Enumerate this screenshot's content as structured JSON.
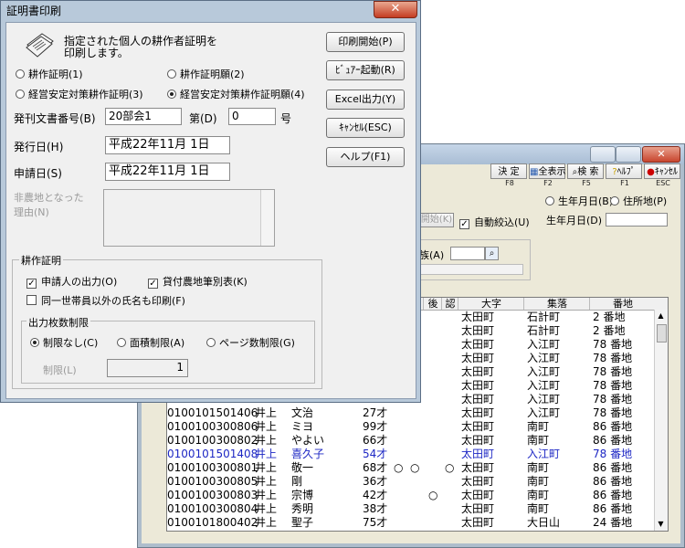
{
  "dialog": {
    "title": "証明書印刷",
    "close_glyph": "✕",
    "description_line1": "指定された個人の耕作者証明を",
    "description_line2": "印刷します。",
    "icon": "document-stack-icon",
    "radios": [
      {
        "label": "耕作証明(1)",
        "selected": false
      },
      {
        "label": "耕作証明願(2)",
        "selected": false
      },
      {
        "label": "経営安定対策耕作証明(3)",
        "selected": false
      },
      {
        "label": "経営安定対策耕作証明願(4)",
        "selected": true
      }
    ],
    "doc_no_label": "発刊文書番号(B)",
    "doc_no_value": "20部会1",
    "dai_label": "第(D)",
    "dai_value": "0",
    "go_label": "号",
    "issue_date_label": "発行日(H)",
    "issue_date_value": "平成22年11月 1日",
    "apply_date_label": "申請日(S)",
    "apply_date_value": "平成22年11月 1日",
    "nonfarm_label_1": "非農地となった",
    "nonfarm_label_2": "理由(N)",
    "group_title": "耕作証明",
    "checks": [
      {
        "label": "申請人の出力(O)",
        "checked": true
      },
      {
        "label": "貸付農地筆別表(K)",
        "checked": true
      },
      {
        "label": "同一世帯員以外の氏名も印刷(F)",
        "checked": false
      }
    ],
    "limit_group_title": "出力枚数制限",
    "limit_radios": [
      {
        "label": "制限なし(C)",
        "selected": true
      },
      {
        "label": "面積制限(A)",
        "selected": false
      },
      {
        "label": "ページ数制限(G)",
        "selected": false
      }
    ],
    "limit_label": "制限(L)",
    "limit_value": "1",
    "buttons": {
      "print": "印刷開始(P)",
      "viewer": "ﾋﾞｭｱｰ起動(R)",
      "excel": "Excel出力(Y)",
      "cancel": "ｷｬﾝｾﾙ(ESC)",
      "help": "ヘルプ(F1)"
    }
  },
  "bg_window": {
    "toolbar": [
      {
        "label": "決 定",
        "key": "F8"
      },
      {
        "label": "全表示",
        "key": "F2"
      },
      {
        "label": "検 索",
        "key": "F5"
      },
      {
        "label": "ﾍﾙﾌﾟ",
        "key": "F1"
      },
      {
        "label": "ｷｬﾝｾﾙ",
        "key": "ESC"
      }
    ],
    "radio_birth": "生年月日(B)",
    "radio_address": "住所地(P)",
    "birth_label": "生年月日(D)",
    "partial_button": "開始(K)",
    "auto_filter": "自動絞込(U)",
    "partial_label": "族(A)",
    "headers": [
      "後",
      "認",
      "大字",
      "集落",
      "番地"
    ],
    "rows": [
      {
        "id": "",
        "sei": "",
        "mei": "",
        "age": "",
        "m1": "",
        "m2": "",
        "m3": "",
        "m4": "",
        "oaza": "太田町",
        "shuraku": "石計町",
        "banchi": "2 番地",
        "hl": false
      },
      {
        "id": "",
        "sei": "",
        "mei": "",
        "age": "",
        "m1": "",
        "m2": "",
        "m3": "",
        "m4": "",
        "oaza": "太田町",
        "shuraku": "石計町",
        "banchi": "2 番地",
        "hl": false
      },
      {
        "id": "",
        "sei": "",
        "mei": "",
        "age": "",
        "m1": "",
        "m2": "",
        "m3": "",
        "m4": "",
        "oaza": "太田町",
        "shuraku": "入江町",
        "banchi": "78 番地",
        "hl": false
      },
      {
        "id": "",
        "sei": "",
        "mei": "",
        "age": "",
        "m1": "",
        "m2": "",
        "m3": "",
        "m4": "",
        "oaza": "太田町",
        "shuraku": "入江町",
        "banchi": "78 番地",
        "hl": false
      },
      {
        "id": "",
        "sei": "",
        "mei": "",
        "age": "",
        "m1": "",
        "m2": "",
        "m3": "",
        "m4": "",
        "oaza": "太田町",
        "shuraku": "入江町",
        "banchi": "78 番地",
        "hl": false
      },
      {
        "id": "",
        "sei": "",
        "mei": "",
        "age": "",
        "m1": "",
        "m2": "",
        "m3": "",
        "m4": "",
        "oaza": "太田町",
        "shuraku": "入江町",
        "banchi": "78 番地",
        "hl": false
      },
      {
        "id": "",
        "sei": "",
        "mei": "",
        "age": "",
        "m1": "",
        "m2": "",
        "m3": "",
        "m4": "",
        "oaza": "太田町",
        "shuraku": "入江町",
        "banchi": "78 番地",
        "hl": false
      },
      {
        "id": "0100101501406",
        "sei": "井上",
        "mei": "文治",
        "age": "27才",
        "m1": "",
        "m2": "",
        "m3": "",
        "m4": "",
        "oaza": "太田町",
        "shuraku": "入江町",
        "banchi": "78 番地",
        "hl": false
      },
      {
        "id": "0100100300806",
        "sei": "井上",
        "mei": "ミヨ",
        "age": "99才",
        "m1": "",
        "m2": "",
        "m3": "",
        "m4": "",
        "oaza": "太田町",
        "shuraku": "南町",
        "banchi": "86 番地",
        "hl": false
      },
      {
        "id": "0100100300802",
        "sei": "井上",
        "mei": "やよい",
        "age": "66才",
        "m1": "",
        "m2": "",
        "m3": "",
        "m4": "",
        "oaza": "太田町",
        "shuraku": "南町",
        "banchi": "86 番地",
        "hl": false
      },
      {
        "id": "0100101501408",
        "sei": "井上",
        "mei": "喜久子",
        "age": "54才",
        "m1": "",
        "m2": "",
        "m3": "",
        "m4": "",
        "oaza": "太田町",
        "shuraku": "入江町",
        "banchi": "78 番地",
        "hl": true
      },
      {
        "id": "0100100300801",
        "sei": "井上",
        "mei": "敬一",
        "age": "68才",
        "m1": "○",
        "m2": "○",
        "m3": "",
        "m4": "○",
        "oaza": "太田町",
        "shuraku": "南町",
        "banchi": "86 番地",
        "hl": false
      },
      {
        "id": "0100100300805",
        "sei": "井上",
        "mei": "剛",
        "age": "36才",
        "m1": "",
        "m2": "",
        "m3": "",
        "m4": "",
        "oaza": "太田町",
        "shuraku": "南町",
        "banchi": "86 番地",
        "hl": false
      },
      {
        "id": "0100100300803",
        "sei": "井上",
        "mei": "宗博",
        "age": "42才",
        "m1": "",
        "m2": "",
        "m3": "○",
        "m4": "",
        "oaza": "太田町",
        "shuraku": "南町",
        "banchi": "86 番地",
        "hl": false
      },
      {
        "id": "0100100300804",
        "sei": "井上",
        "mei": "秀明",
        "age": "38才",
        "m1": "",
        "m2": "",
        "m3": "",
        "m4": "",
        "oaza": "太田町",
        "shuraku": "南町",
        "banchi": "86 番地",
        "hl": false
      },
      {
        "id": "0100101800402",
        "sei": "井上",
        "mei": "聖子",
        "age": "75才",
        "m1": "",
        "m2": "",
        "m3": "",
        "m4": "",
        "oaza": "太田町",
        "shuraku": "大日山",
        "banchi": "24 番地",
        "hl": false
      }
    ]
  }
}
